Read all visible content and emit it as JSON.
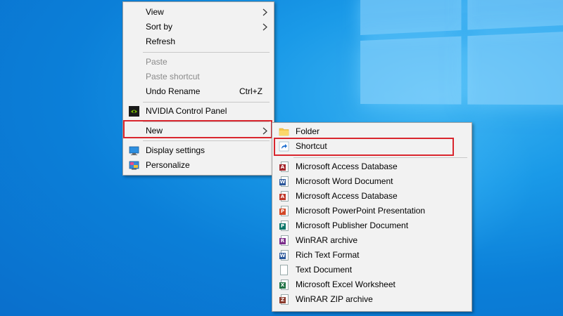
{
  "context_menu": {
    "items": [
      {
        "label": "View"
      },
      {
        "label": "Sort by"
      },
      {
        "label": "Refresh"
      },
      {
        "label": "Paste"
      },
      {
        "label": "Paste shortcut"
      },
      {
        "label": "Undo Rename",
        "shortcut": "Ctrl+Z"
      },
      {
        "label": "NVIDIA Control Panel"
      },
      {
        "label": "New"
      },
      {
        "label": "Display settings"
      },
      {
        "label": "Personalize"
      }
    ]
  },
  "new_submenu": {
    "items": [
      {
        "label": "Folder"
      },
      {
        "label": "Shortcut"
      },
      {
        "label": "Microsoft Access Database"
      },
      {
        "label": "Microsoft Word Document"
      },
      {
        "label": "Microsoft Access Database"
      },
      {
        "label": "Microsoft PowerPoint Presentation"
      },
      {
        "label": "Microsoft Publisher Document"
      },
      {
        "label": "WinRAR archive"
      },
      {
        "label": "Rich Text Format"
      },
      {
        "label": "Text Document"
      },
      {
        "label": "Microsoft Excel Worksheet"
      },
      {
        "label": "WinRAR ZIP archive"
      }
    ]
  },
  "colors": {
    "highlight_border": "#d9262e",
    "menu_background": "#f2f2f2",
    "desktop_blue": "#0b7fd8"
  },
  "icons": {
    "nvidia": "nvidia-icon",
    "display_settings": "display-settings-icon",
    "personalize": "personalize-icon",
    "folder": "folder-icon",
    "shortcut": "shortcut-icon"
  }
}
